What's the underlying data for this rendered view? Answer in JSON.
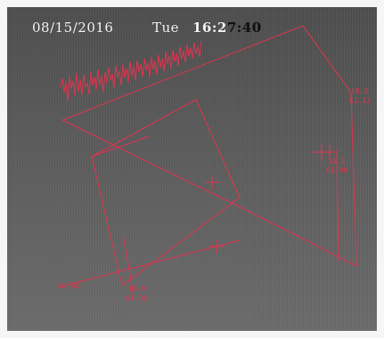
{
  "osd": {
    "date": "08/15/2016",
    "day": "Tue",
    "time_head": "16:2",
    "time_tail": "7:40"
  },
  "labels": {
    "right_top_a": "10.3",
    "right_top_b": "61.17",
    "mid_right_a": "10.1",
    "mid_right_b": "61.00",
    "bottom_left": "61.00",
    "bottom_mid_a": "10.0",
    "bottom_mid_b": "61.00"
  },
  "colors": {
    "annotation": "#e2334e"
  }
}
